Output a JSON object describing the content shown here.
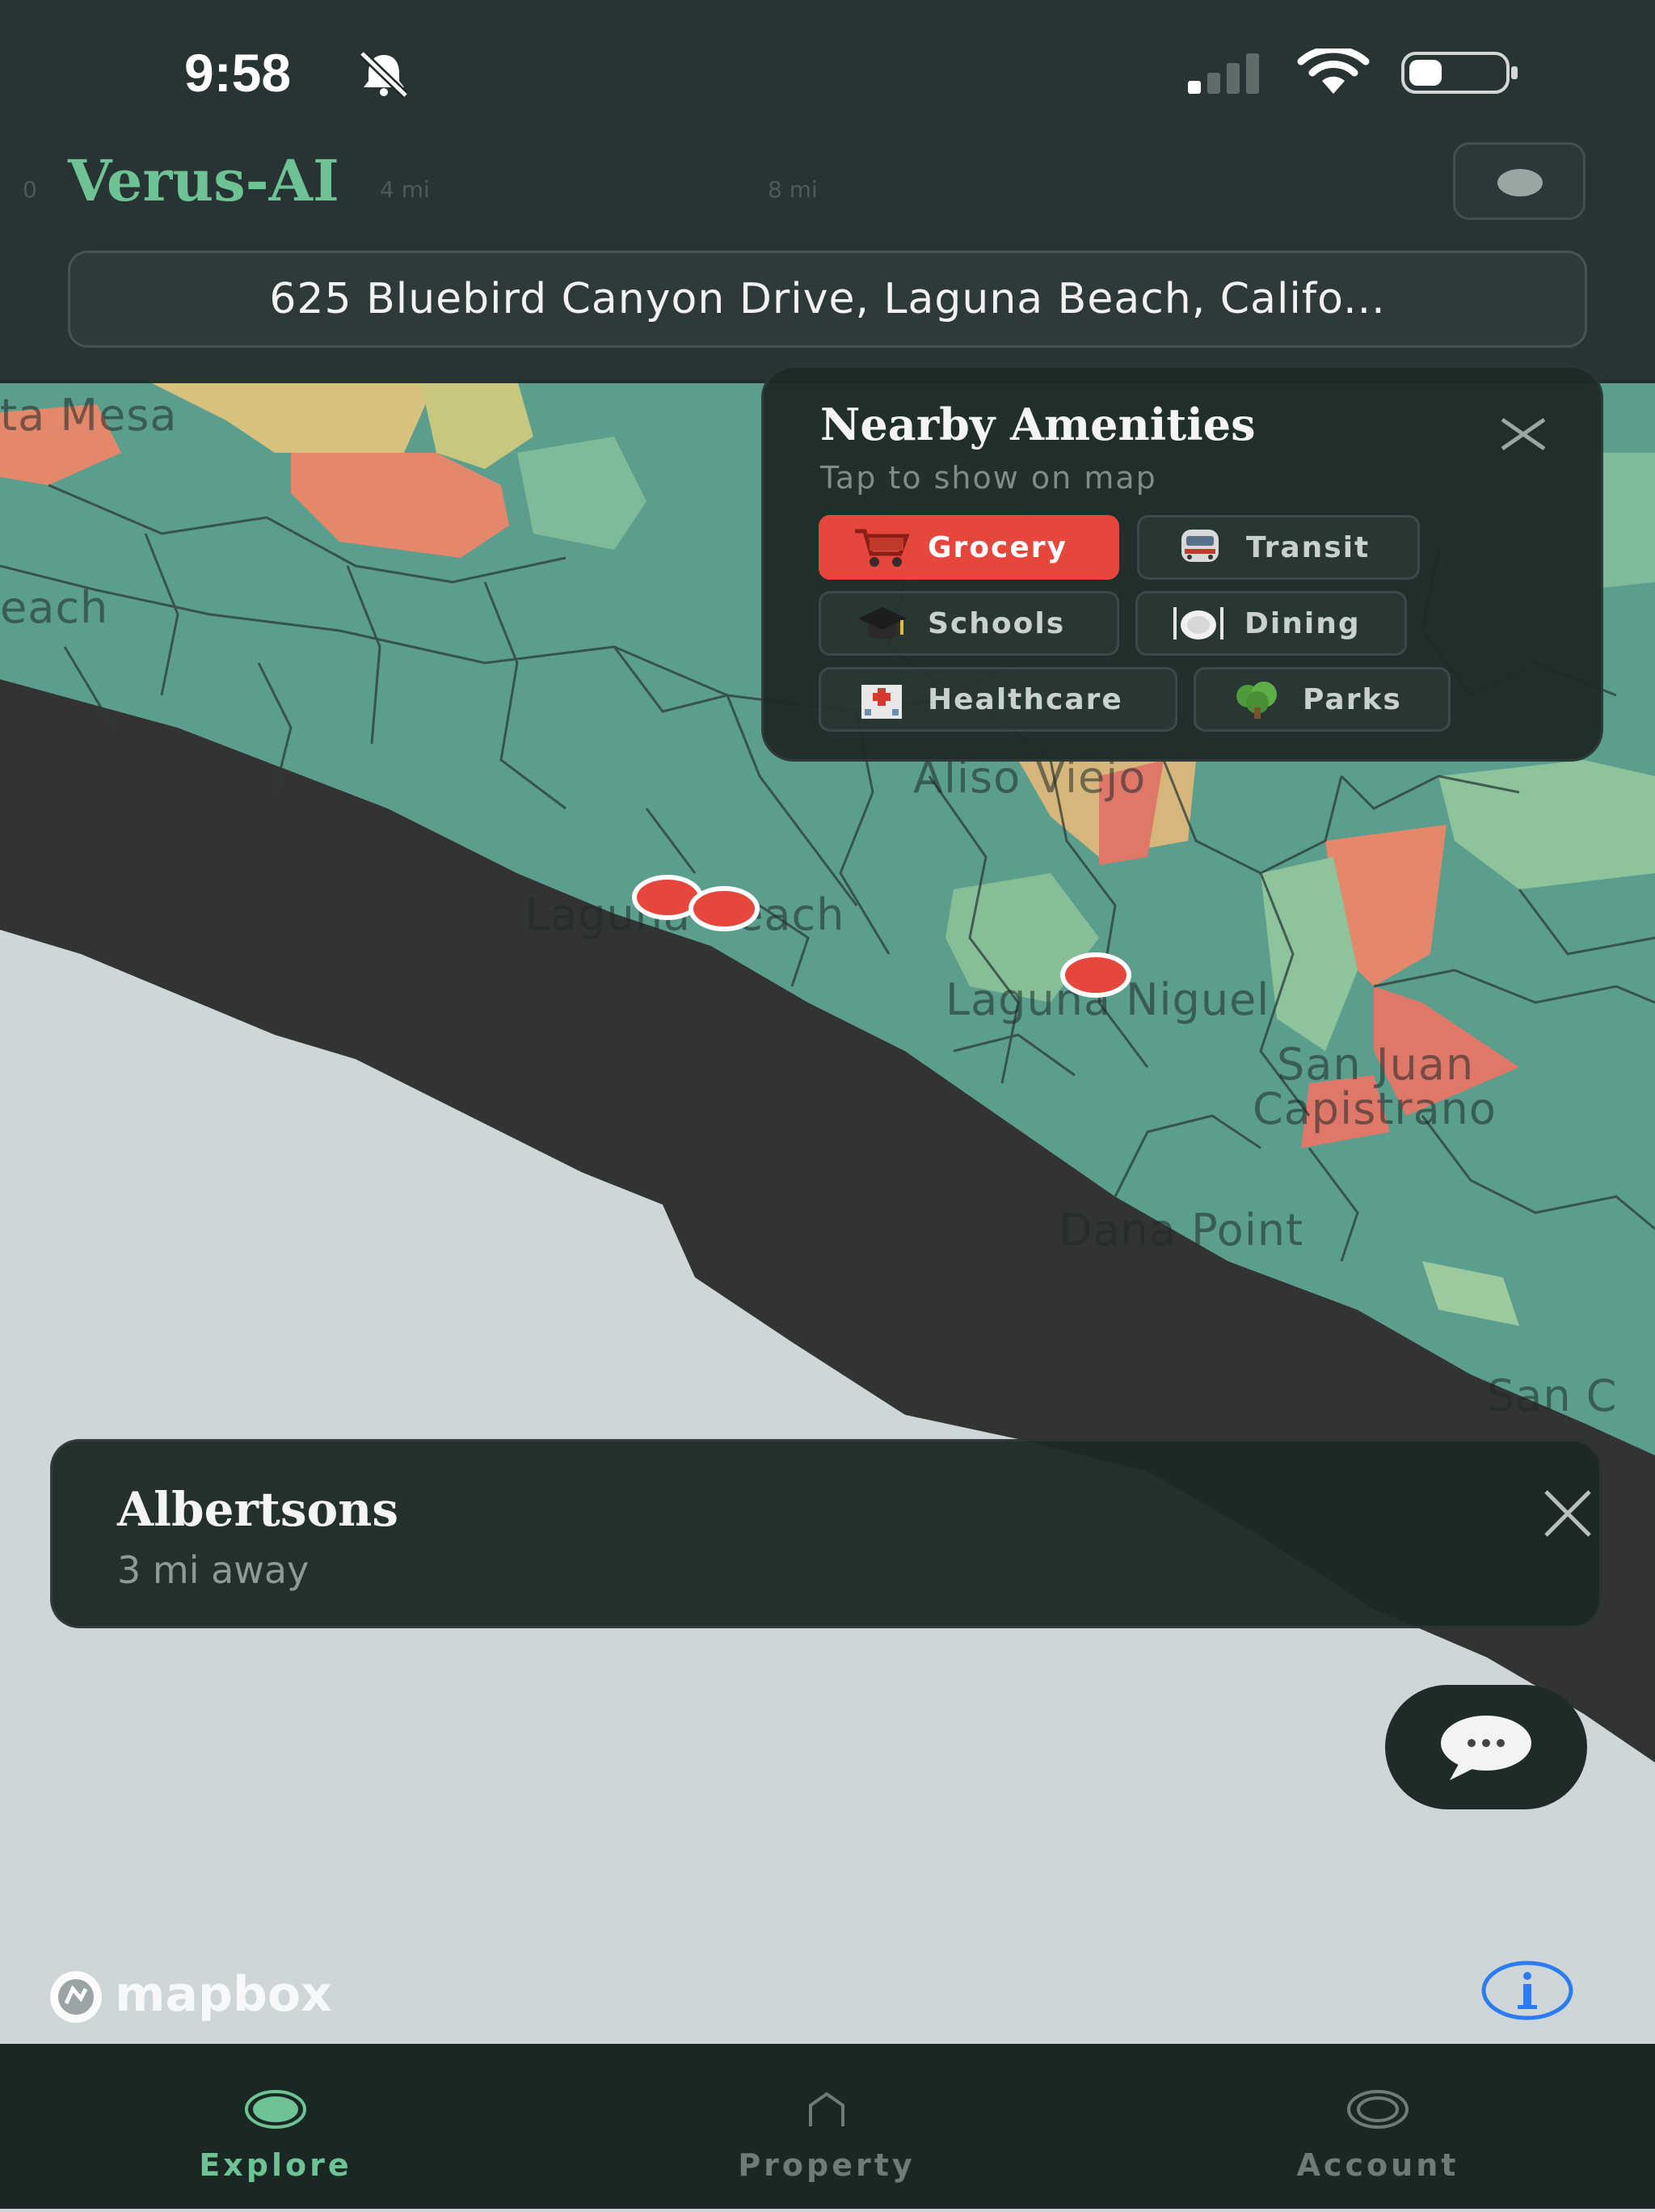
{
  "status_bar": {
    "time": "9:58"
  },
  "header": {
    "brand": "Verus-AI",
    "address": "625 Bluebird Canyon Drive, Laguna Beach, Califo...",
    "scale_labels": [
      "0",
      "4 mi",
      "8 mi"
    ]
  },
  "map": {
    "place_labels": [
      "ta Mesa",
      "each",
      "Aliso Viejo",
      "Laguna Beach",
      "Laguna Niguel",
      "San Juan",
      "Capistrano",
      "Dana Point",
      "San C"
    ]
  },
  "amenities": {
    "title": "Nearby Amenities",
    "subtitle": "Tap to show on map",
    "items": [
      {
        "label": "Grocery",
        "icon": "shopping-cart-icon",
        "active": true
      },
      {
        "label": "Transit",
        "icon": "train-icon",
        "active": false
      },
      {
        "label": "Schools",
        "icon": "graduation-cap-icon",
        "active": false
      },
      {
        "label": "Dining",
        "icon": "plate-icon",
        "active": false
      },
      {
        "label": "Healthcare",
        "icon": "hospital-icon",
        "active": false
      },
      {
        "label": "Parks",
        "icon": "tree-icon",
        "active": false
      }
    ]
  },
  "info_card": {
    "title": "Albertsons",
    "distance": "3 mi away"
  },
  "attribution": {
    "logo_text": "mapbox"
  },
  "tabbar": {
    "items": [
      {
        "label": "Explore",
        "icon": "explore-icon",
        "active": true
      },
      {
        "label": "Property",
        "icon": "house-icon",
        "active": false
      },
      {
        "label": "Account",
        "icon": "account-icon",
        "active": false
      }
    ]
  },
  "colors": {
    "accent_green": "#6dc394",
    "marker_red": "#e5473c",
    "panel_bg": "#1e2a28",
    "ocean": "#cfd6d8",
    "coast": "#323232"
  }
}
